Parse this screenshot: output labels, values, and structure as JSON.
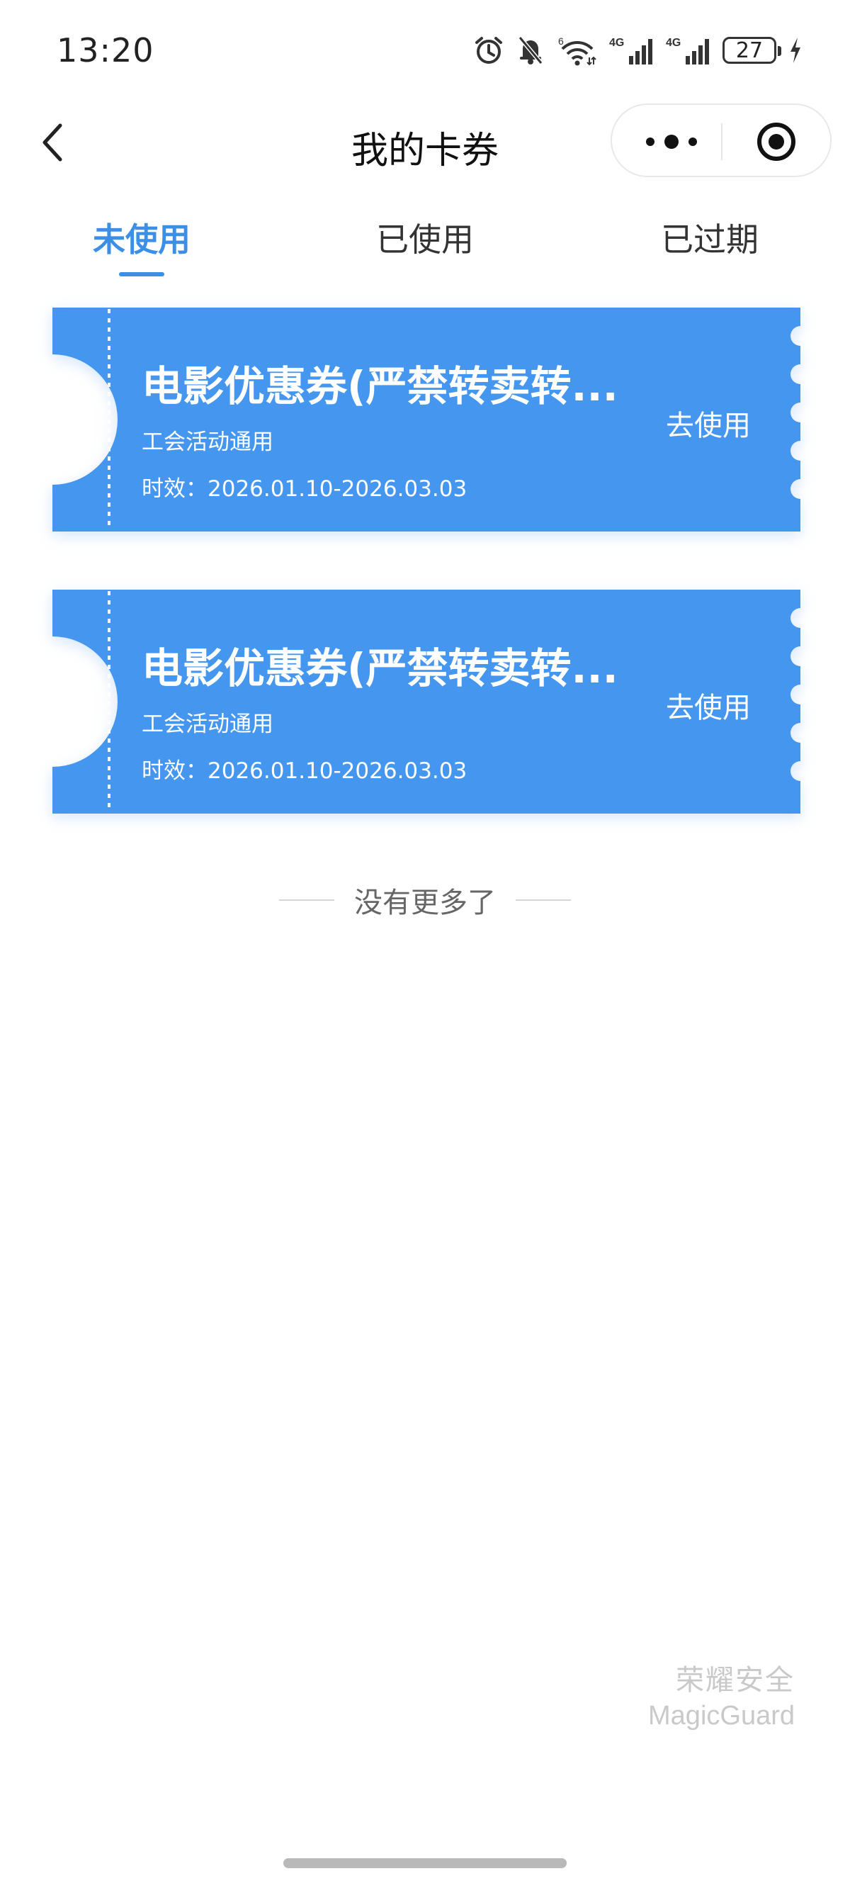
{
  "status_bar": {
    "time": "13:20",
    "wifi_badge": "6",
    "signal1_label": "4G",
    "signal2_label": "4G",
    "battery_level": "27",
    "icons": [
      "alarm-icon",
      "bell-muted-icon",
      "wifi-icon",
      "signal-4g-icon",
      "signal-4g-icon",
      "battery-icon",
      "charging-icon"
    ]
  },
  "nav": {
    "title": "我的卡券",
    "back_icon": "chevron-left-icon",
    "more_icon": "more-dots-icon",
    "close_icon": "target-circle-icon"
  },
  "tabs": [
    {
      "label": "未使用",
      "active": true
    },
    {
      "label": "已使用",
      "active": false
    },
    {
      "label": "已过期",
      "active": false
    }
  ],
  "coupons": [
    {
      "title": "电影优惠券(严禁转卖转...",
      "scope": "工会活动通用",
      "validity": "时效：2026.01.10-2026.03.03",
      "action": "去使用"
    },
    {
      "title": "电影优惠券(严禁转卖转...",
      "scope": "工会活动通用",
      "validity": "时效：2026.01.10-2026.03.03",
      "action": "去使用"
    }
  ],
  "footer": {
    "no_more": "没有更多了"
  },
  "watermark": {
    "cn": "荣耀安全",
    "en": "MagicGuard"
  },
  "colors": {
    "accent": "#3d8fe6",
    "coupon_bg": "#4596ee",
    "text": "#222222",
    "muted": "#666666"
  }
}
